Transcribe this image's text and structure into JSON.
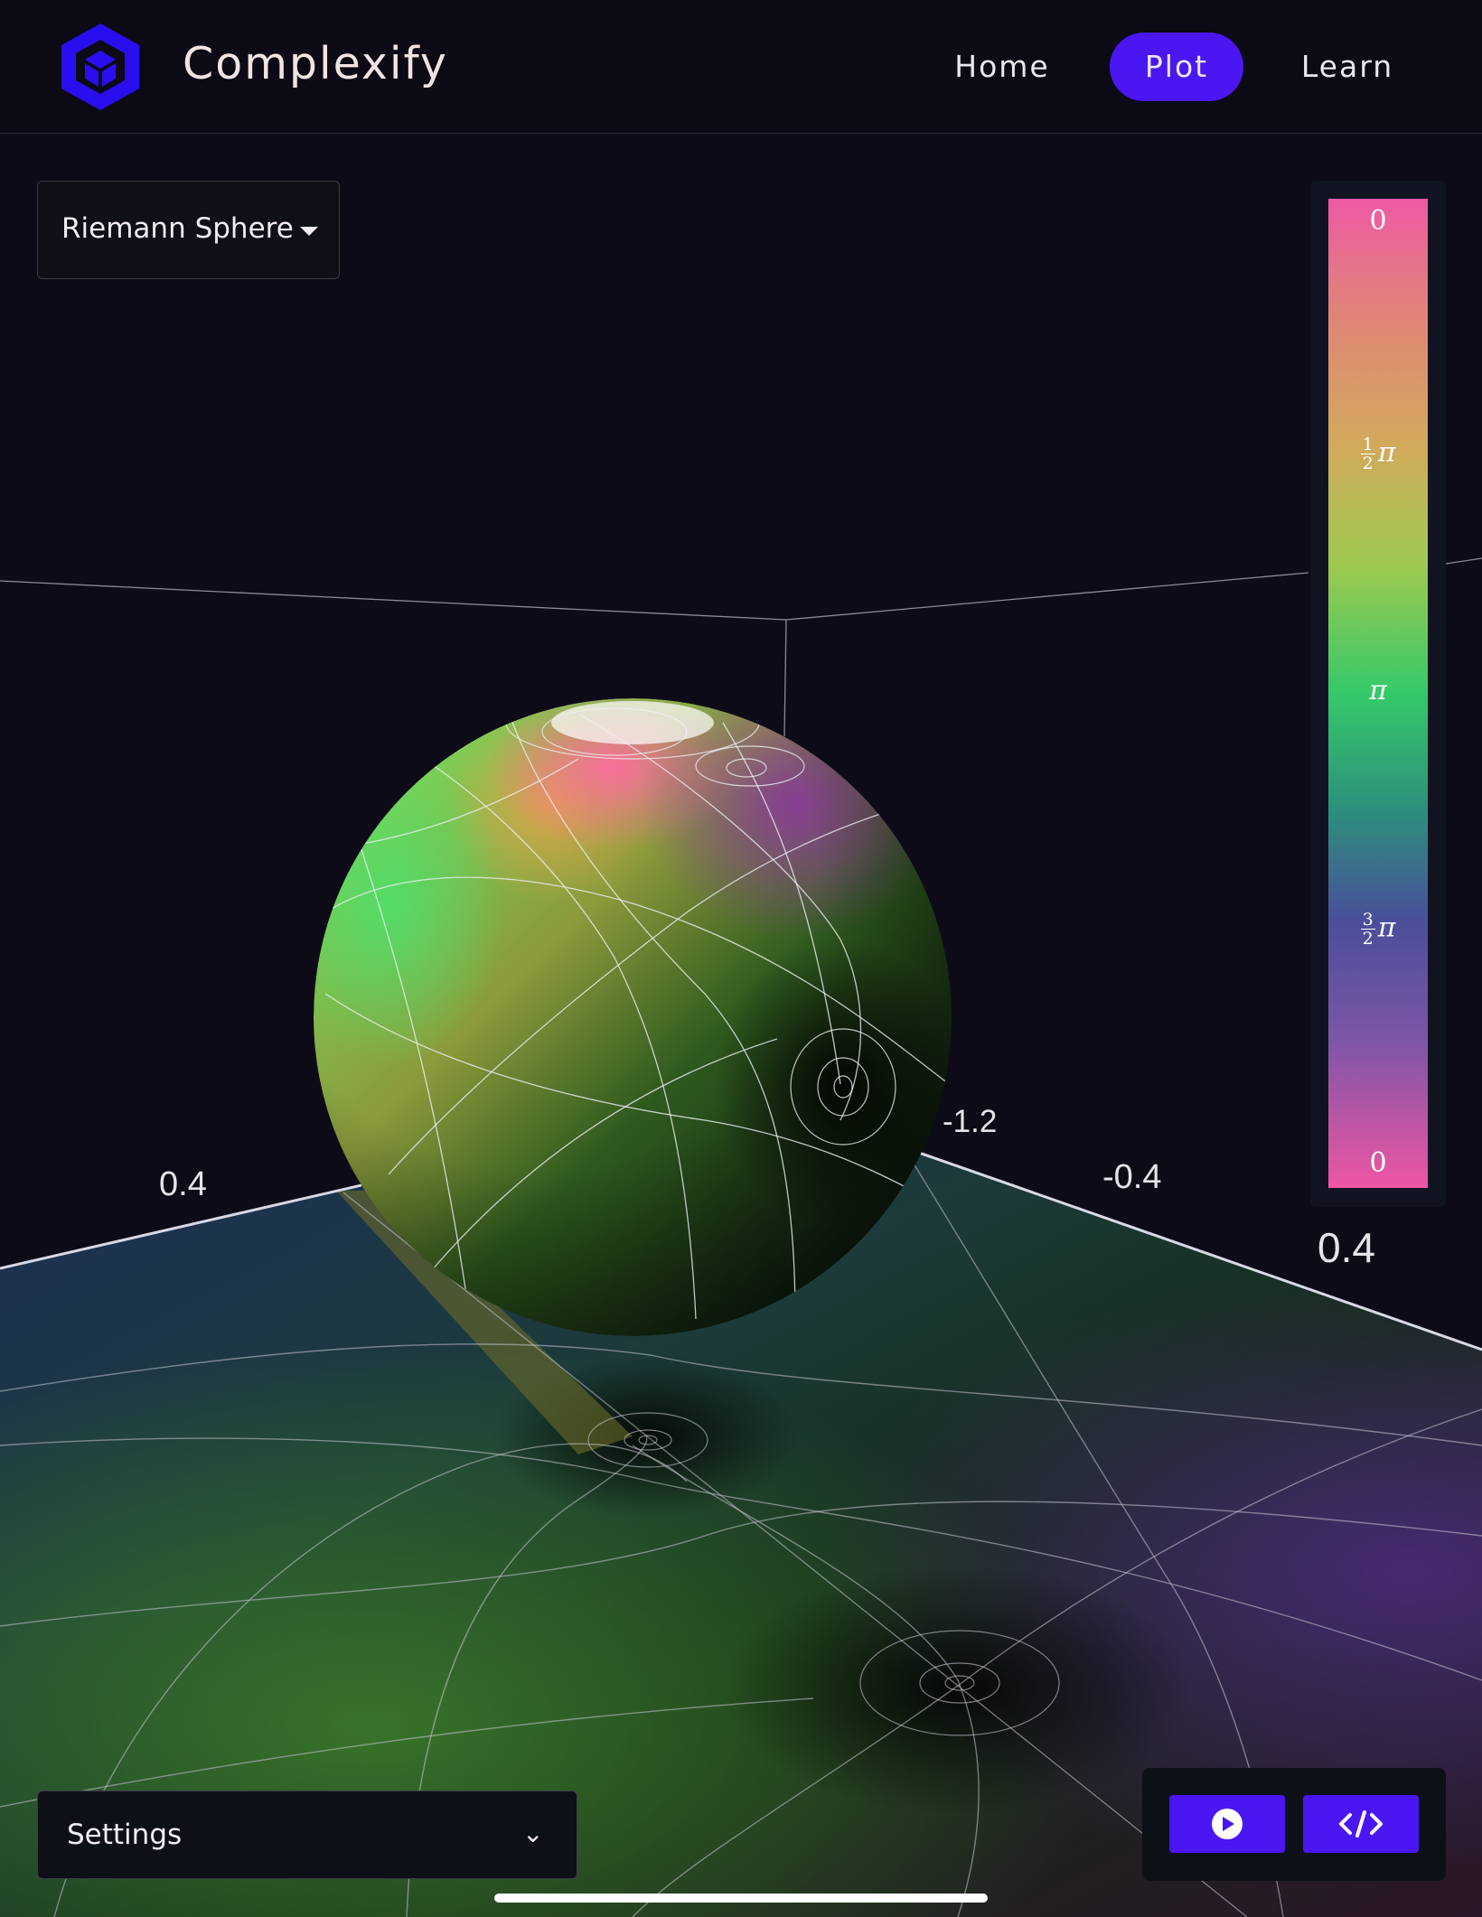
{
  "app": {
    "title": "Complexify",
    "accent": "#4a17f2"
  },
  "nav": {
    "home": "Home",
    "plot": "Plot",
    "learn": "Learn",
    "active": "Plot"
  },
  "view_select": {
    "value": "Riemann Sphere"
  },
  "axes": {
    "left_label": "0.4",
    "center_label": "-1.2",
    "right_label_1": "-0.4",
    "right_label_2": "0.4"
  },
  "legend": {
    "top": "0",
    "half_num": "1",
    "half_den": "2",
    "half_pi": "π",
    "pi": "π",
    "three_half_num": "3",
    "three_half_den": "2",
    "three_half_pi": "π",
    "bottom": "0"
  },
  "settings": {
    "label": "Settings"
  },
  "toolbar": {
    "play_icon": "play-icon",
    "code_icon": "code-icon"
  }
}
